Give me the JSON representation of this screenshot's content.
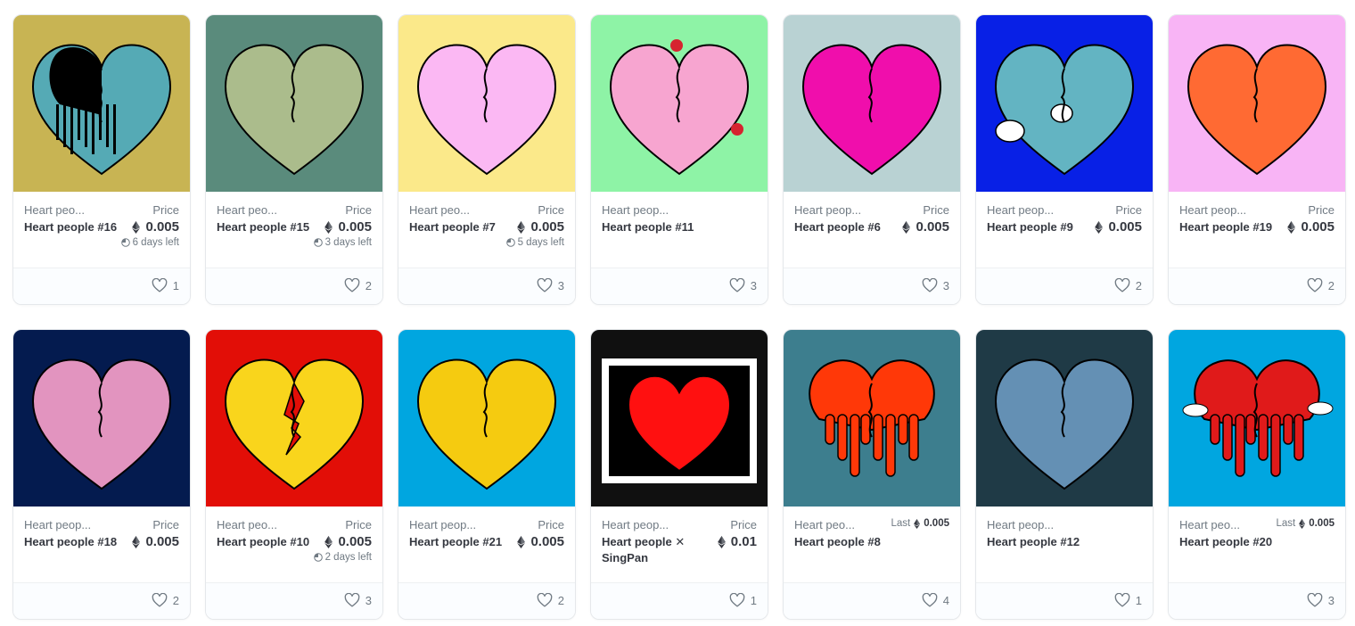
{
  "cards": [
    {
      "bg": "#c8b453",
      "heart": "#55aab5",
      "accent": "#000000",
      "variant": "drip-split",
      "collection": "Heart peo...",
      "name": "Heart people #16",
      "price_label": "Price",
      "price": "0.005",
      "time": "6 days left",
      "last": "",
      "likes": "1"
    },
    {
      "bg": "#5a8b7c",
      "heart": "#abbc8c",
      "accent": "#000000",
      "variant": "plain",
      "collection": "Heart peo...",
      "name": "Heart people #15",
      "price_label": "Price",
      "price": "0.005",
      "time": "3 days left",
      "last": "",
      "likes": "2"
    },
    {
      "bg": "#fbe98a",
      "heart": "#fbb8f3",
      "accent": "#000000",
      "variant": "plain",
      "collection": "Heart peo...",
      "name": "Heart people #7",
      "price_label": "Price",
      "price": "0.005",
      "time": "5 days left",
      "last": "",
      "likes": "3"
    },
    {
      "bg": "#8ef3a6",
      "heart": "#f7a5d0",
      "accent": "#d6232f",
      "variant": "flowers",
      "collection": "Heart peop...",
      "name": "Heart people #11",
      "price_label": "",
      "price": "",
      "time": "",
      "last": "",
      "likes": "3"
    },
    {
      "bg": "#b9d2d3",
      "heart": "#f00eac",
      "accent": "#000000",
      "variant": "plain",
      "collection": "Heart peop...",
      "name": "Heart people #6",
      "price_label": "Price",
      "price": "0.005",
      "time": "",
      "last": "",
      "likes": "3"
    },
    {
      "bg": "#0820e6",
      "heart": "#63b4c2",
      "accent": "#ffffff",
      "variant": "bubbles",
      "collection": "Heart peop...",
      "name": "Heart people #9",
      "price_label": "Price",
      "price": "0.005",
      "time": "",
      "last": "",
      "likes": "2"
    },
    {
      "bg": "#f8b4f5",
      "heart": "#ff6a33",
      "accent": "#000000",
      "variant": "plain",
      "collection": "Heart peop...",
      "name": "Heart people #19",
      "price_label": "Price",
      "price": "0.005",
      "time": "",
      "last": "",
      "likes": "2"
    },
    {
      "bg": "#041b4f",
      "heart": "#e294bf",
      "accent": "#000000",
      "variant": "plain",
      "collection": "Heart peop...",
      "name": "Heart people #18",
      "price_label": "Price",
      "price": "0.005",
      "time": "",
      "last": "",
      "likes": "2"
    },
    {
      "bg": "#e20e07",
      "heart": "#f9d51c",
      "accent": "#e20e07",
      "variant": "broken",
      "collection": "Heart peo...",
      "name": "Heart people #10",
      "price_label": "Price",
      "price": "0.005",
      "time": "2 days left",
      "last": "",
      "likes": "3"
    },
    {
      "bg": "#00a6e0",
      "heart": "#f5cb10",
      "accent": "#000000",
      "variant": "plain",
      "collection": "Heart peop...",
      "name": "Heart people #21",
      "price_label": "Price",
      "price": "0.005",
      "time": "",
      "last": "",
      "likes": "2"
    },
    {
      "bg": "#101010",
      "heart": "#ff1010",
      "accent": "#ffffff",
      "variant": "frame",
      "collection": "Heart peop...",
      "name": "Heart people ✕ SingPan",
      "price_label": "Price",
      "price": "0.01",
      "time": "",
      "last": "",
      "likes": "1"
    },
    {
      "bg": "#3d7e8e",
      "heart": "#ff3808",
      "accent": "#000000",
      "variant": "drip",
      "collection": "Heart peo...",
      "name": "Heart people #8",
      "price_label": "",
      "price": "",
      "time": "",
      "last": "Last",
      "last_price": "0.005",
      "likes": "4"
    },
    {
      "bg": "#1f3a46",
      "heart": "#6490b4",
      "accent": "#000000",
      "variant": "plain",
      "collection": "Heart peop...",
      "name": "Heart people #12",
      "price_label": "",
      "price": "",
      "time": "",
      "last": "",
      "likes": "1"
    },
    {
      "bg": "#00a6e0",
      "heart": "#e01a1a",
      "accent": "#ffffff",
      "variant": "drip-clouds",
      "collection": "Heart peo...",
      "name": "Heart people #20",
      "price_label": "",
      "price": "",
      "time": "",
      "last": "Last",
      "last_price": "0.005",
      "likes": "3"
    }
  ],
  "icons": {
    "currency": "ethereum-icon",
    "time": "clock-icon",
    "favorite": "heart-outline-icon"
  }
}
